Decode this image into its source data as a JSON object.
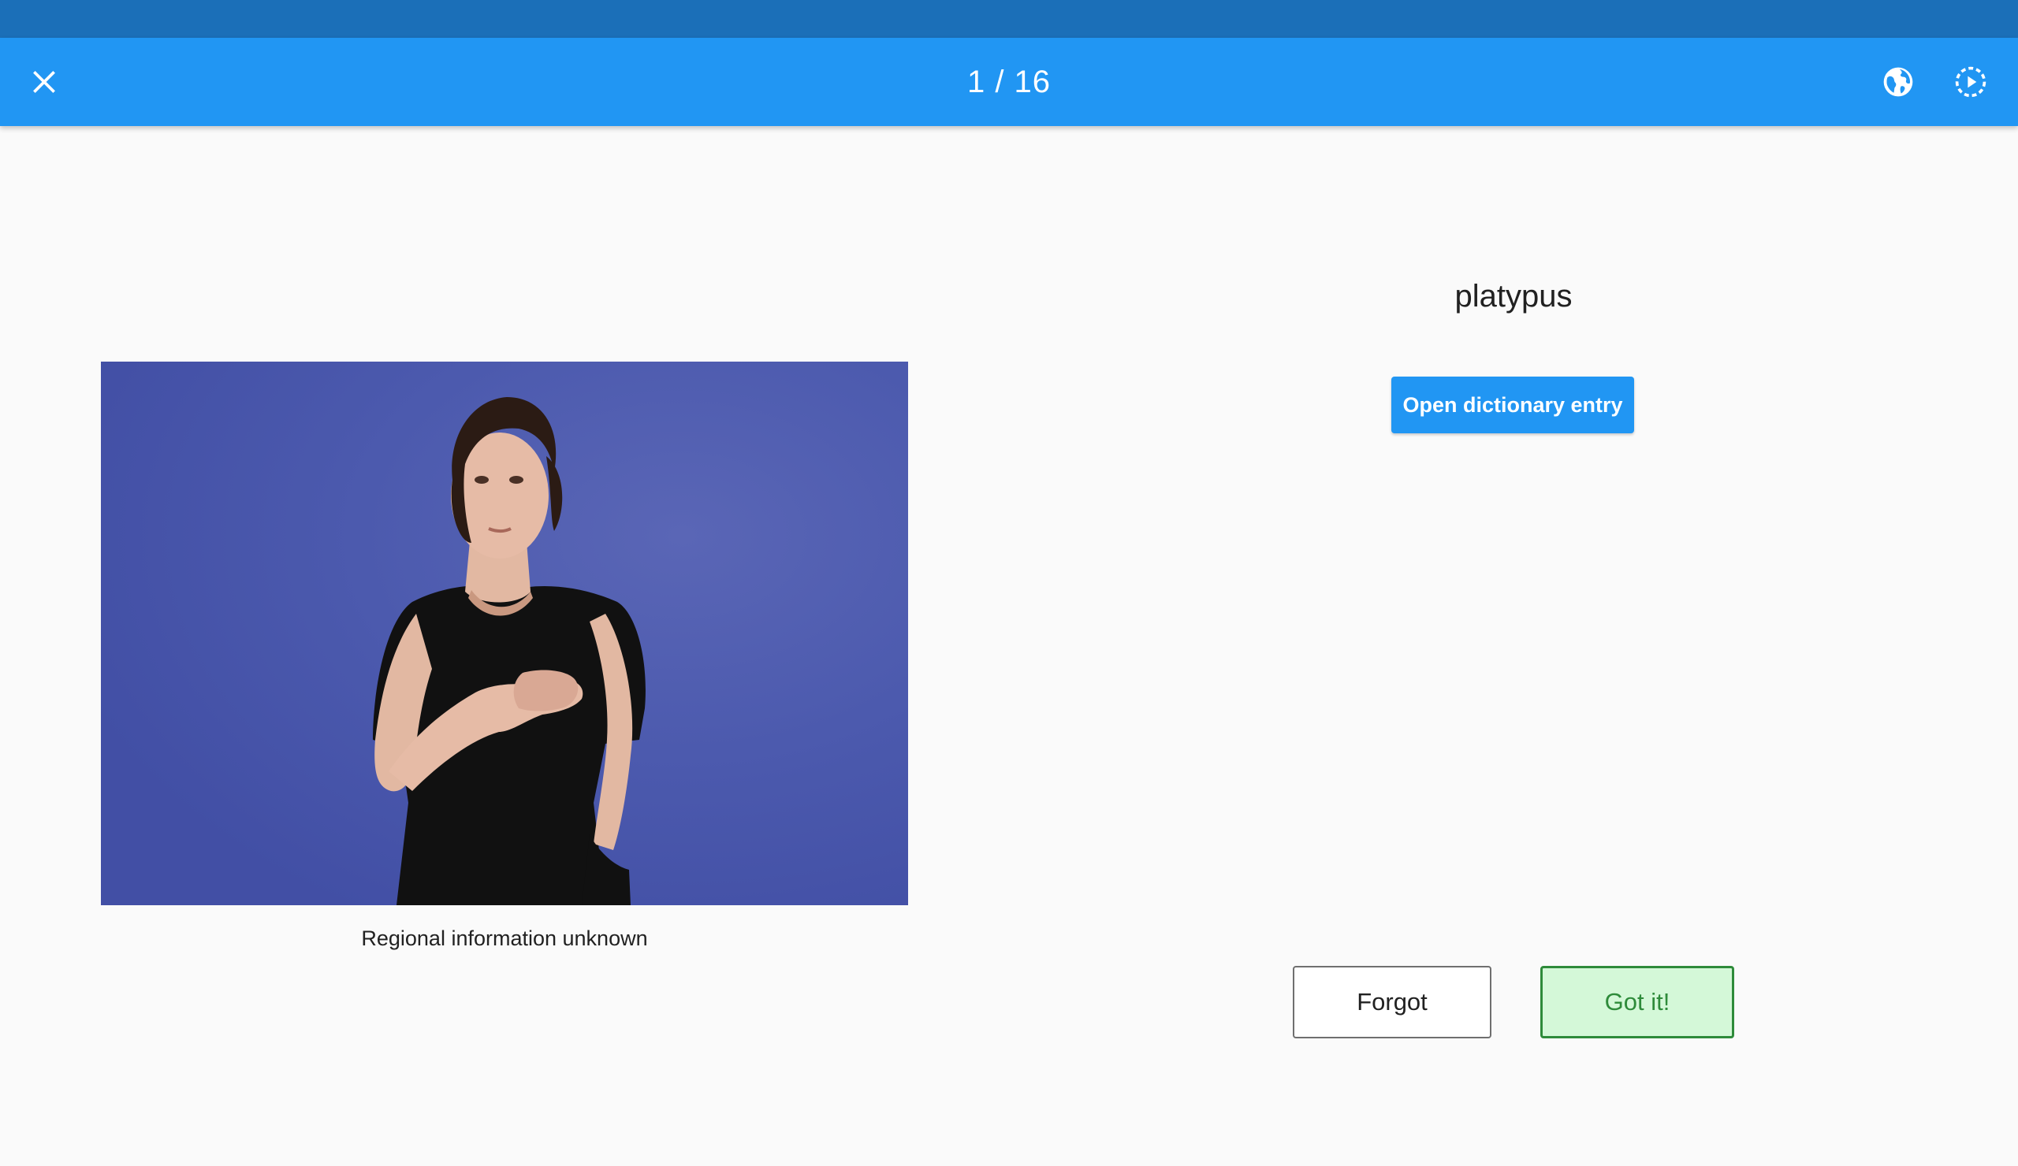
{
  "app_bar": {
    "progress_label": "1 / 16",
    "close_icon": "close-icon",
    "globe_icon": "globe-icon",
    "replay_icon": "play-circle-icon",
    "color": "#2196f3",
    "status_bar_color": "#1b6fb8"
  },
  "video": {
    "caption": "Regional information unknown",
    "background_color": "#4a58ad"
  },
  "card": {
    "word": "platypus",
    "dictionary_button_label": "Open dictionary entry"
  },
  "answer_buttons": {
    "forgot_label": "Forgot",
    "got_it_label": "Got it!",
    "got_it_color": "#2e8b3a"
  }
}
